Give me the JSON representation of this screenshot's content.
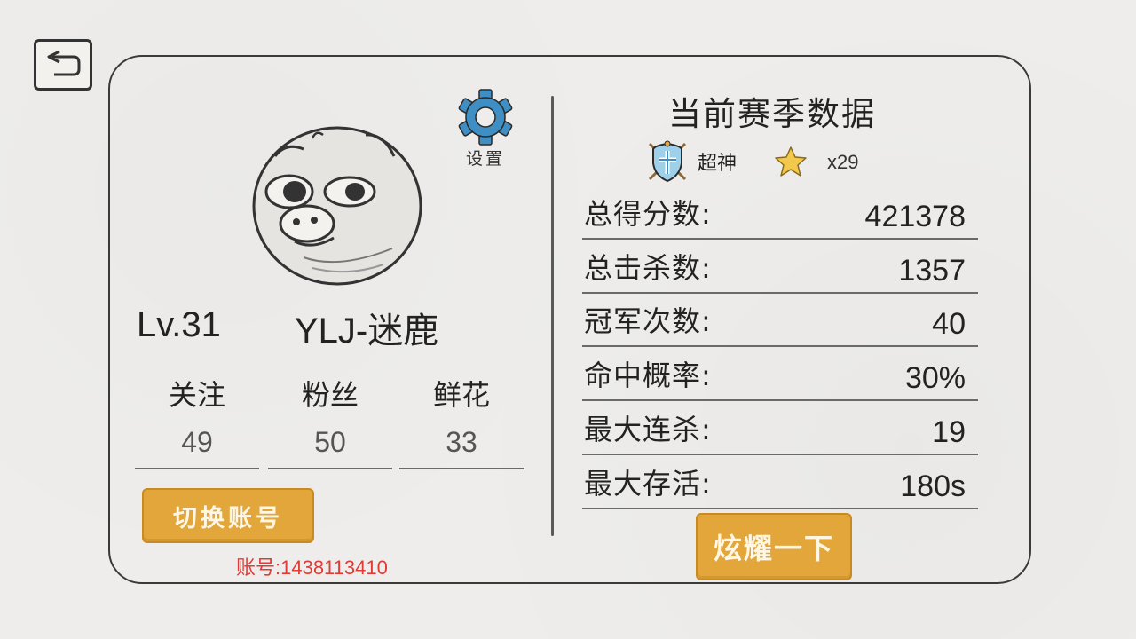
{
  "profile": {
    "settings_label": "设置",
    "level": "Lv.31",
    "nickname": "YLJ-迷鹿",
    "social": [
      {
        "label": "关注",
        "value": "49"
      },
      {
        "label": "粉丝",
        "value": "50"
      },
      {
        "label": "鲜花",
        "value": "33"
      }
    ],
    "switch_account_label": "切换账号",
    "account_text": "账号:1438113410"
  },
  "season": {
    "title": "当前赛季数据",
    "rank_name": "超神",
    "star_count": "x29",
    "stats": [
      {
        "label": "总得分数:",
        "value": "421378"
      },
      {
        "label": "总击杀数:",
        "value": "1357"
      },
      {
        "label": "冠军次数:",
        "value": "40"
      },
      {
        "label": "命中概率:",
        "value": "30%"
      },
      {
        "label": "最大连杀:",
        "value": "19"
      },
      {
        "label": "最大存活:",
        "value": "180s"
      }
    ],
    "show_off_label": "炫耀一下"
  },
  "icons": {
    "back": "back-arrow-icon",
    "settings": "gear-icon",
    "rank": "rank-shield-icon",
    "star": "star-icon"
  },
  "colors": {
    "button_orange": "#e2a63b",
    "account_red": "#e23b35",
    "gear_blue": "#3f8fc4"
  }
}
